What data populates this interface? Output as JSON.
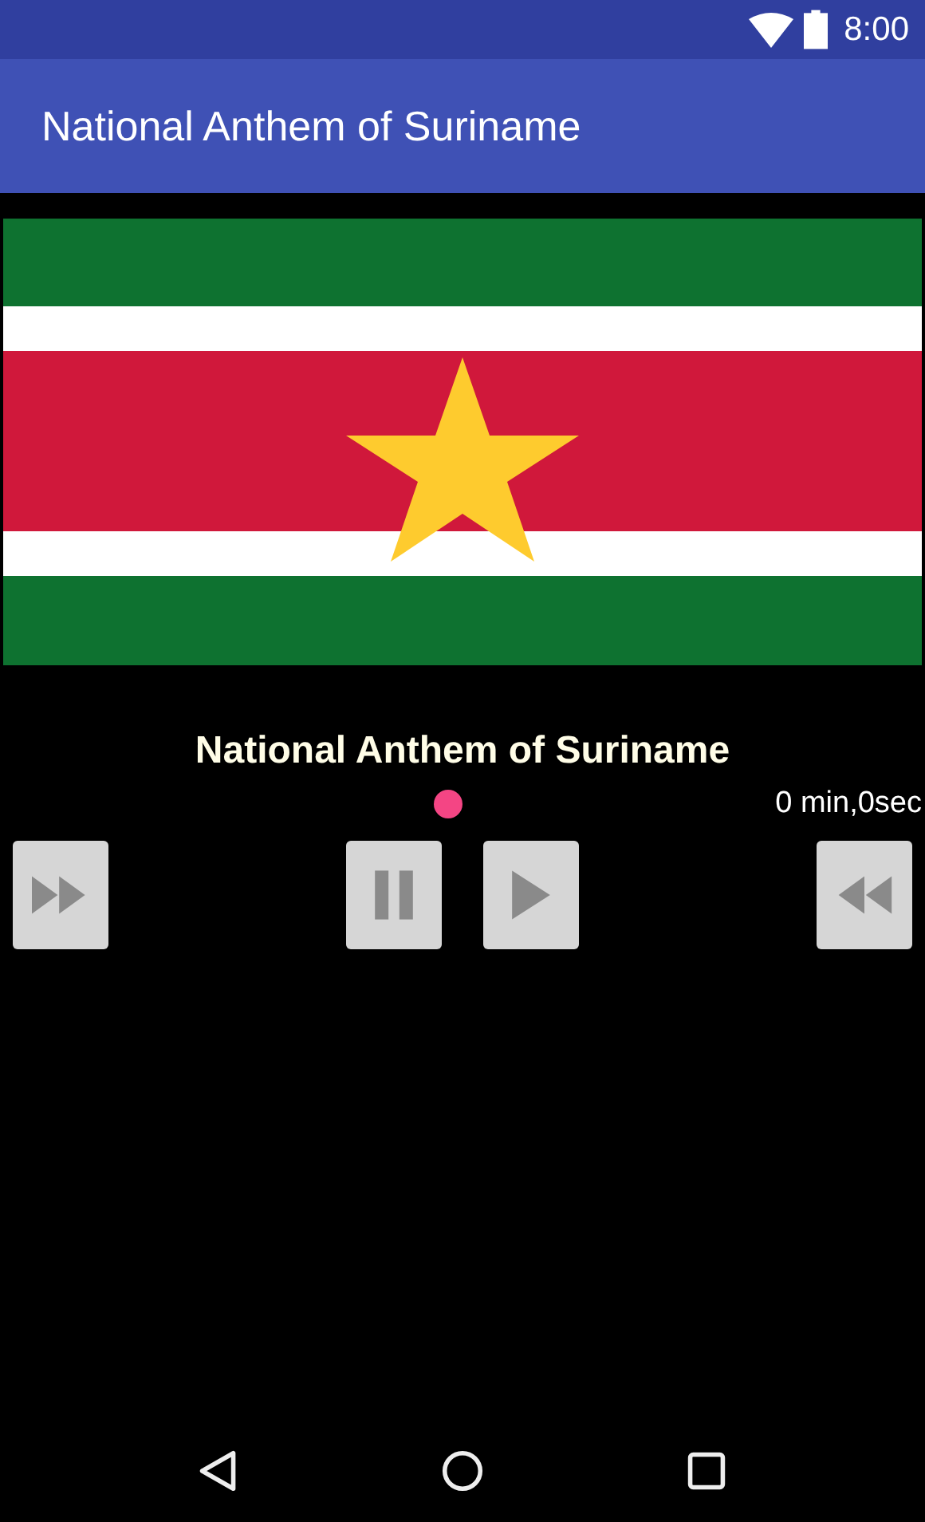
{
  "status_bar": {
    "time": "8:00"
  },
  "app_bar": {
    "title": "National Anthem of Suriname"
  },
  "player": {
    "title": "National Anthem of Suriname",
    "elapsed": "0 min,0sec",
    "buttons": [
      {
        "kind": "forward"
      },
      {
        "kind": "pause"
      },
      {
        "kind": "play"
      },
      {
        "kind": "rewind"
      }
    ]
  }
}
